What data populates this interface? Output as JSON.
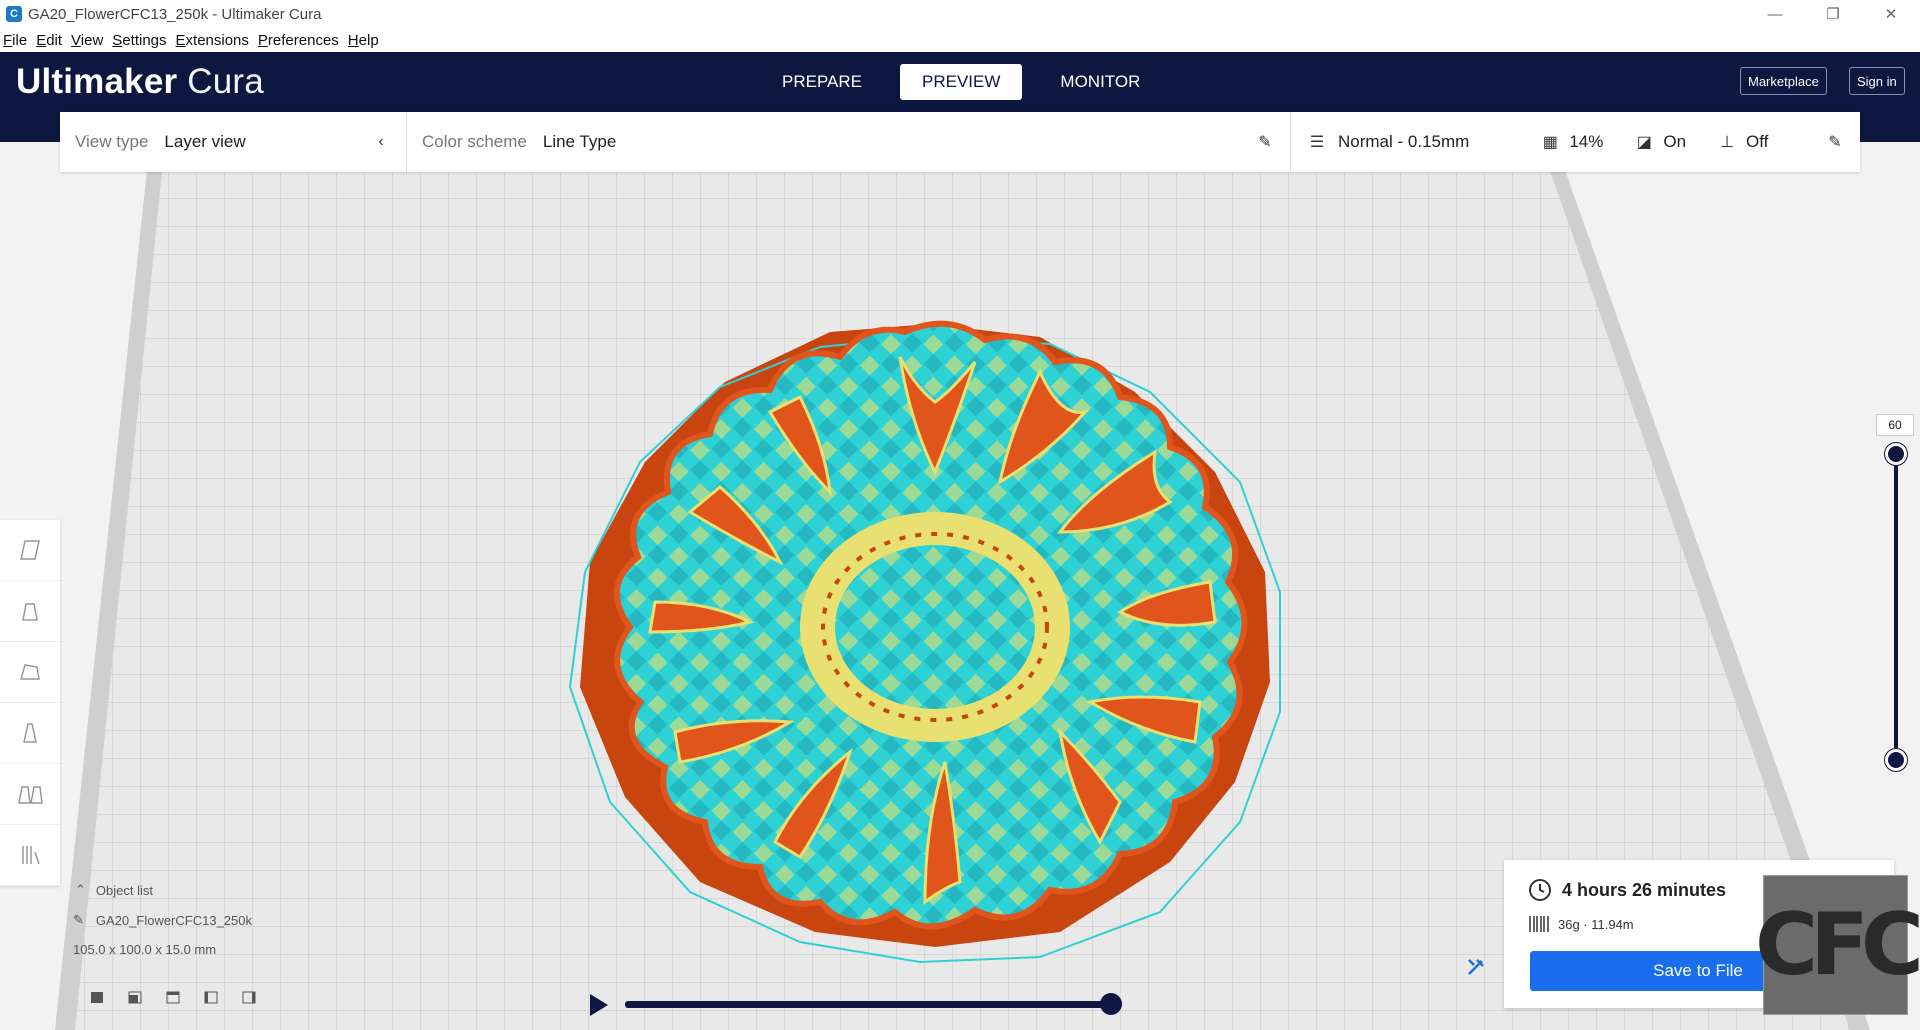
{
  "window": {
    "title": "GA20_FlowerCFC13_250k - Ultimaker Cura",
    "app_icon_letter": "C",
    "minimize": "—",
    "restore": "❐",
    "close": "✕"
  },
  "menu": [
    {
      "u": "F",
      "rest": "ile"
    },
    {
      "u": "E",
      "rest": "dit"
    },
    {
      "u": "V",
      "rest": "iew"
    },
    {
      "u": "S",
      "rest": "ettings"
    },
    {
      "u": "E",
      "rest": "xtensions"
    },
    {
      "u": "P",
      "rest": "references"
    },
    {
      "u": "H",
      "rest": "elp"
    }
  ],
  "header": {
    "logo_brand": "Ultimaker",
    "logo_product": "Cura",
    "tabs": [
      "PREPARE",
      "PREVIEW",
      "MONITOR"
    ],
    "active_tab": "PREVIEW",
    "marketplace": "Marketplace",
    "signin": "Sign in"
  },
  "toolbar": {
    "view_type_label": "View type",
    "view_type_value": "Layer view",
    "color_scheme_label": "Color scheme",
    "color_scheme_value": "Line Type",
    "profile": "Normal - 0.15mm",
    "infill": "14%",
    "support": "On",
    "adhesion": "Off"
  },
  "object": {
    "list_label": "Object list",
    "name": "GA20_FlowerCFC13_250k",
    "dimensions": "105.0 x 100.0 x 15.0 mm"
  },
  "layer_slider": {
    "current_layer": "60",
    "position": 1.0
  },
  "playback": {
    "progress": 1.0
  },
  "summary": {
    "time": "4 hours 26 minutes",
    "material": "36g · 11.94m",
    "save_label": "Save to File"
  },
  "watermark": "CFC",
  "colors": {
    "header_bg": "#0d1740",
    "save_button": "#196ef0",
    "infill": "#2ed1d4",
    "shell": "#e0551c",
    "skin": "#e8e070"
  },
  "icons": {
    "tool_icons": [
      "move-icon",
      "scale-icon",
      "rotate-icon",
      "mirror-icon",
      "per-model-settings-icon",
      "support-blocker-icon"
    ],
    "view_icons": [
      "3d-view-icon",
      "front-view-icon",
      "top-view-icon",
      "left-view-icon",
      "right-view-icon"
    ]
  }
}
